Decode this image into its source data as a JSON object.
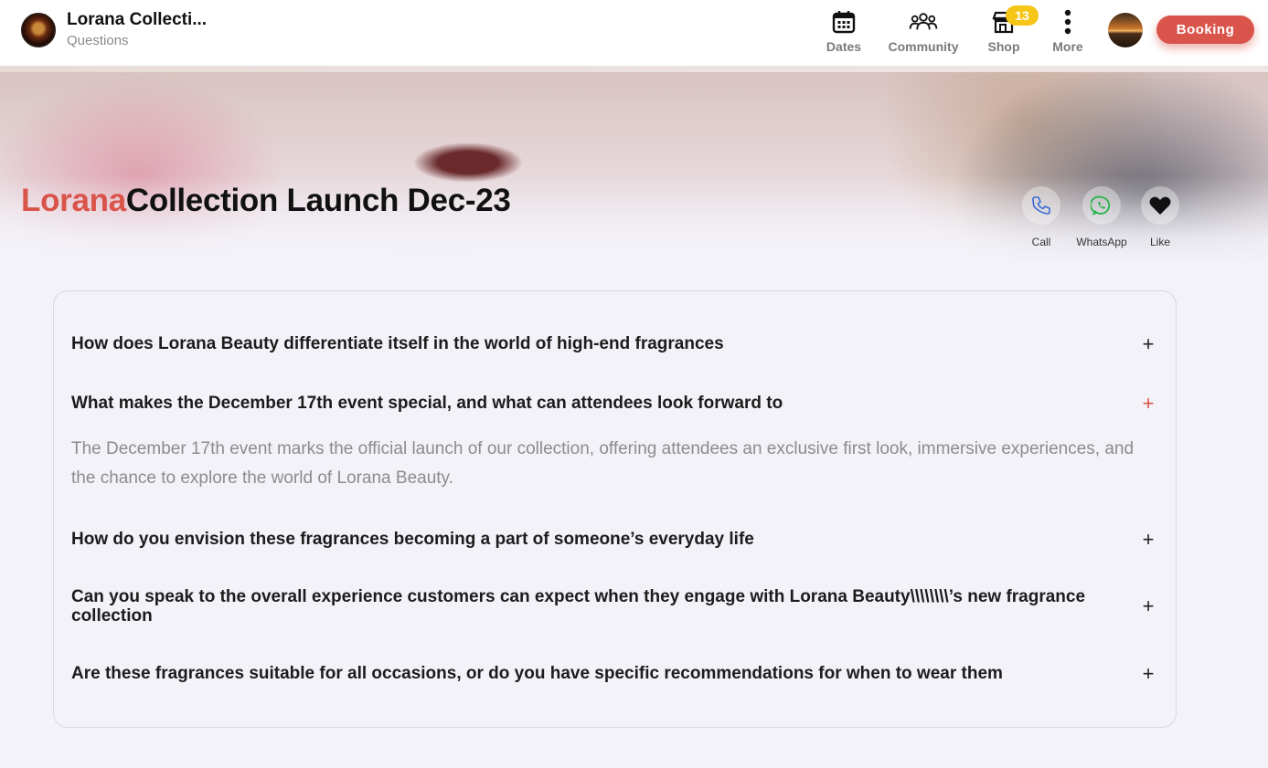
{
  "header": {
    "brand_title": "Lorana Collecti...",
    "brand_subtitle": "Questions",
    "nav": [
      {
        "label": "Dates",
        "icon": "calendar-icon"
      },
      {
        "label": "Community",
        "icon": "community-icon"
      },
      {
        "label": "Shop",
        "icon": "shop-icon"
      },
      {
        "label": "More",
        "icon": "more-vertical-icon"
      }
    ],
    "shop_badge": "13",
    "booking_label": "Booking",
    "accent_color": "#d9544a",
    "badge_color": "#f5c518"
  },
  "hero": {
    "title_accent": "Lorana",
    "title_rest": "Collection Launch Dec-23",
    "actions": [
      {
        "label": "Call",
        "icon": "phone-icon"
      },
      {
        "label": "WhatsApp",
        "icon": "whatsapp-icon"
      },
      {
        "label": "Like",
        "icon": "heart-icon"
      }
    ]
  },
  "faq": {
    "items": [
      {
        "question": "How does Lorana Beauty differentiate itself in the world of high-end fragrances",
        "open": false
      },
      {
        "question": "What makes the December 17th event special, and what can attendees look forward to",
        "open": true,
        "answer": "The December 17th event marks the official launch of our collection, offering attendees an exclusive first look, immersive experiences, and the chance to explore the world of Lorana Beauty."
      },
      {
        "question": "How do you envision these fragrances becoming a part of someone’s everyday life",
        "open": false
      },
      {
        "question": "Can you speak to the overall experience customers can expect when they engage with Lorana Beauty\\\\\\\\\\\\\\\\’s new fragrance collection",
        "open": false
      },
      {
        "question": "Are these fragrances suitable for all occasions, or do you have specific recommendations for when to wear them",
        "open": false
      }
    ],
    "toggle_symbol": "+"
  }
}
